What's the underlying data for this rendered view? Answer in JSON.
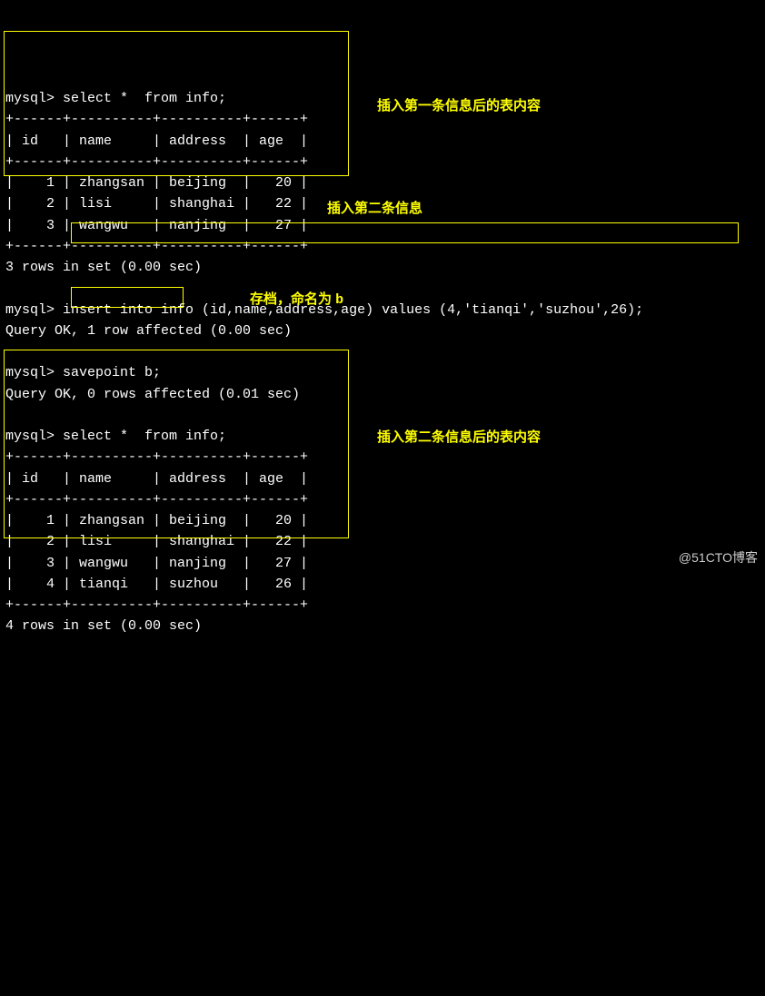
{
  "prompt": "mysql>",
  "queries": {
    "select1": "select *  from info;",
    "insert": "insert into info (id,name,address,age) values (4,'tianqi','suzhou',26);",
    "savepoint": "savepoint b;",
    "select2": "select *  from info;"
  },
  "table1": {
    "border_top": "+------+----------+----------+------+",
    "header": "| id   | name     | address  | age  |",
    "rows": [
      "|    1 | zhangsan | beijing  |   20 |",
      "|    2 | lisi     | shanghai |   22 |",
      "|    3 | wangwu   | nanjing  |   27 |"
    ],
    "footer": "3 rows in set (0.00 sec)"
  },
  "responses": {
    "insert_ok": "Query OK, 1 row affected (0.00 sec)",
    "savepoint_ok": "Query OK, 0 rows affected (0.01 sec)"
  },
  "table2": {
    "border_top": "+------+----------+----------+------+",
    "header": "| id   | name     | address  | age  |",
    "rows": [
      "|    1 | zhangsan | beijing  |   20 |",
      "|    2 | lisi     | shanghai |   22 |",
      "|    3 | wangwu   | nanjing  |   27 |",
      "|    4 | tianqi   | suzhou   |   26 |"
    ],
    "footer": "4 rows in set (0.00 sec)"
  },
  "annotations": {
    "first_insert": "插入第一条信息后的表内容",
    "second_insert_header": "插入第二条信息",
    "savepoint_label_prefix": "存档，命名为 ",
    "savepoint_label_kw": "b",
    "second_insert_content": "插入第二条信息后的表内容"
  },
  "watermark": "@51CTO博客",
  "chart_data": [
    {
      "type": "table",
      "title": "info (after first insert)",
      "columns": [
        "id",
        "name",
        "address",
        "age"
      ],
      "rows": [
        [
          1,
          "zhangsan",
          "beijing",
          20
        ],
        [
          2,
          "lisi",
          "shanghai",
          22
        ],
        [
          3,
          "wangwu",
          "nanjing",
          27
        ]
      ]
    },
    {
      "type": "table",
      "title": "info (after second insert)",
      "columns": [
        "id",
        "name",
        "address",
        "age"
      ],
      "rows": [
        [
          1,
          "zhangsan",
          "beijing",
          20
        ],
        [
          2,
          "lisi",
          "shanghai",
          22
        ],
        [
          3,
          "wangwu",
          "nanjing",
          27
        ],
        [
          4,
          "tianqi",
          "suzhou",
          26
        ]
      ]
    }
  ]
}
